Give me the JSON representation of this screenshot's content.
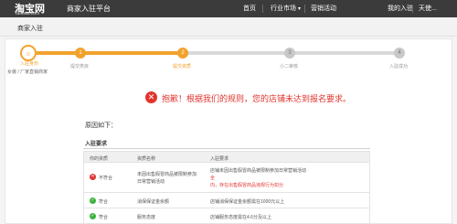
{
  "topbar": {
    "logo": "淘宝网",
    "logo_sub": "Taobao.com",
    "platform_title": "商家入驻平台",
    "nav": {
      "home": "首页",
      "market": "行业市场",
      "activity": "营销活动",
      "my_application": "我的入驻",
      "user": "天使..."
    }
  },
  "breadcrumb": "商家入驻",
  "progress": {
    "user_caption": "入驻身份",
    "user_sub": "女装 / 厂家直销商家",
    "steps": [
      {
        "num": "1",
        "label": "提交类目"
      },
      {
        "num": "2",
        "label": "提交资质"
      },
      {
        "num": "3",
        "label": "小二审核"
      },
      {
        "num": "4",
        "label": "入驻成功"
      }
    ]
  },
  "error": {
    "icon": "✕",
    "message": "抱歉！根据我们的规则，您的店铺未达到报名要求。"
  },
  "reason_label": "原因如下：",
  "requirements": {
    "title": "入驻要求",
    "headers": [
      "你的资质",
      "资质名称",
      "入驻要求"
    ],
    "rows": [
      {
        "status": "不符合",
        "status_type": "bad",
        "name_line1": "未因出售假冒商品被限制参加",
        "name_line2": "日常营销活动",
        "req_line1": "店铺未因出售假冒商品被限制参加日常营销活动",
        "req_line2": "全",
        "req_line3": "内，存在出售假冒商品违规行为扣分"
      },
      {
        "status": "符合",
        "status_type": "ok",
        "name_line1": "消保保证金余额",
        "req_line1": "店铺消保保证金余额需在1000元以上"
      },
      {
        "status": "符合",
        "status_type": "ok",
        "name_line1": "服务态度",
        "req_line1": "店铺服务态度需在4.6分及以上"
      }
    ]
  },
  "colors": {
    "accent": "#f2a22c",
    "error": "#e0352e",
    "ok": "#3bb33b",
    "topbar": "#3b3b3b"
  }
}
